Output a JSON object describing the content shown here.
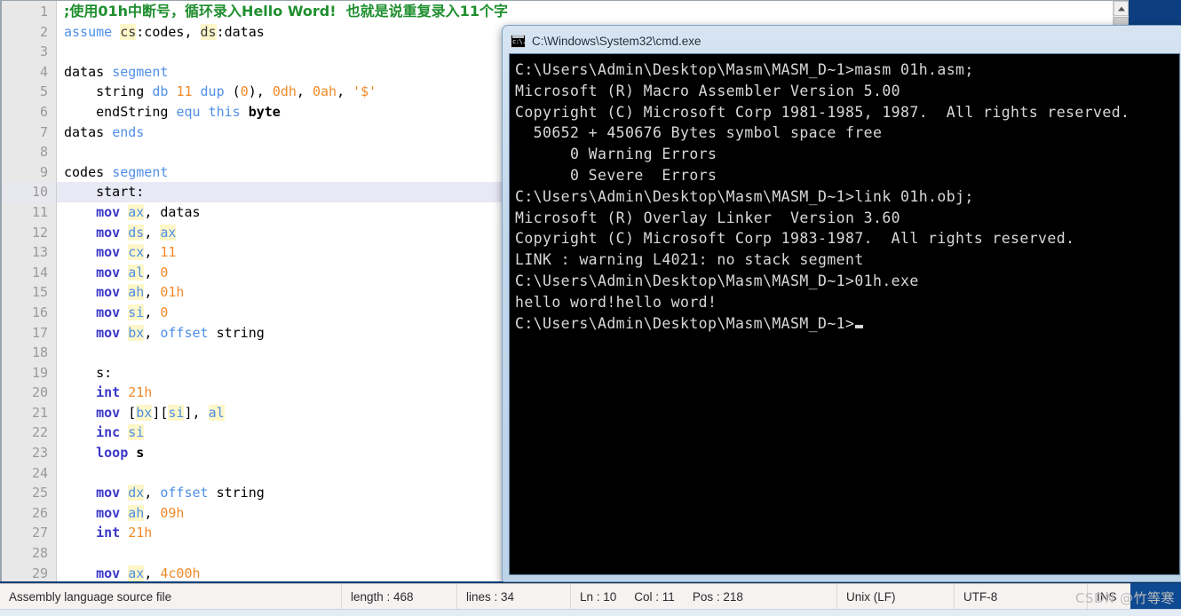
{
  "editor": {
    "current_line": 10,
    "lines": [
      {
        "n": 1,
        "tokens": [
          {
            "t": ";使用01h中断号，循环录入Hello Word!  也就是说重复录入11个字",
            "c": "tk-comment"
          }
        ]
      },
      {
        "n": 2,
        "tokens": [
          {
            "t": "assume ",
            "c": "tk-kw"
          },
          {
            "t": "cs",
            "c": "tk-reg-d"
          },
          {
            "t": ":codes, ",
            "c": "tk-plain"
          },
          {
            "t": "ds",
            "c": "tk-reg-d"
          },
          {
            "t": ":datas",
            "c": "tk-plain"
          }
        ]
      },
      {
        "n": 3,
        "tokens": [
          {
            "t": "",
            "c": "tk-plain"
          }
        ]
      },
      {
        "n": 4,
        "tokens": [
          {
            "t": "datas ",
            "c": "tk-plain"
          },
          {
            "t": "segment",
            "c": "tk-kw"
          }
        ]
      },
      {
        "n": 5,
        "tokens": [
          {
            "t": "    string ",
            "c": "tk-plain"
          },
          {
            "t": "db",
            "c": "tk-kw"
          },
          {
            "t": " ",
            "c": "tk-plain"
          },
          {
            "t": "11",
            "c": "tk-num"
          },
          {
            "t": " ",
            "c": "tk-plain"
          },
          {
            "t": "dup",
            "c": "tk-kw"
          },
          {
            "t": " (",
            "c": "tk-plain"
          },
          {
            "t": "0",
            "c": "tk-num"
          },
          {
            "t": "), ",
            "c": "tk-plain"
          },
          {
            "t": "0dh",
            "c": "tk-num"
          },
          {
            "t": ", ",
            "c": "tk-plain"
          },
          {
            "t": "0ah",
            "c": "tk-num"
          },
          {
            "t": ", ",
            "c": "tk-plain"
          },
          {
            "t": "'$'",
            "c": "tk-str"
          }
        ]
      },
      {
        "n": 6,
        "tokens": [
          {
            "t": "    endString ",
            "c": "tk-plain"
          },
          {
            "t": "equ",
            "c": "tk-kw"
          },
          {
            "t": " ",
            "c": "tk-plain"
          },
          {
            "t": "this",
            "c": "tk-kw"
          },
          {
            "t": " ",
            "c": "tk-plain"
          },
          {
            "t": "byte",
            "c": "tk-bold"
          }
        ]
      },
      {
        "n": 7,
        "tokens": [
          {
            "t": "datas ",
            "c": "tk-plain"
          },
          {
            "t": "ends",
            "c": "tk-kw"
          }
        ]
      },
      {
        "n": 8,
        "tokens": [
          {
            "t": "",
            "c": "tk-plain"
          }
        ]
      },
      {
        "n": 9,
        "tokens": [
          {
            "t": "codes ",
            "c": "tk-plain"
          },
          {
            "t": "segment",
            "c": "tk-kw"
          }
        ]
      },
      {
        "n": 10,
        "tokens": [
          {
            "t": "    start:",
            "c": "tk-plain"
          }
        ]
      },
      {
        "n": 11,
        "tokens": [
          {
            "t": "    ",
            "c": "tk-plain"
          },
          {
            "t": "mov",
            "c": "tk-ins"
          },
          {
            "t": " ",
            "c": "tk-plain"
          },
          {
            "t": "ax",
            "c": "tk-reg"
          },
          {
            "t": ", datas",
            "c": "tk-plain"
          }
        ]
      },
      {
        "n": 12,
        "tokens": [
          {
            "t": "    ",
            "c": "tk-plain"
          },
          {
            "t": "mov",
            "c": "tk-ins"
          },
          {
            "t": " ",
            "c": "tk-plain"
          },
          {
            "t": "ds",
            "c": "tk-reg"
          },
          {
            "t": ", ",
            "c": "tk-plain"
          },
          {
            "t": "ax",
            "c": "tk-reg"
          }
        ]
      },
      {
        "n": 13,
        "tokens": [
          {
            "t": "    ",
            "c": "tk-plain"
          },
          {
            "t": "mov",
            "c": "tk-ins"
          },
          {
            "t": " ",
            "c": "tk-plain"
          },
          {
            "t": "cx",
            "c": "tk-reg"
          },
          {
            "t": ", ",
            "c": "tk-plain"
          },
          {
            "t": "11",
            "c": "tk-num"
          }
        ]
      },
      {
        "n": 14,
        "tokens": [
          {
            "t": "    ",
            "c": "tk-plain"
          },
          {
            "t": "mov",
            "c": "tk-ins"
          },
          {
            "t": " ",
            "c": "tk-plain"
          },
          {
            "t": "al",
            "c": "tk-reg"
          },
          {
            "t": ", ",
            "c": "tk-plain"
          },
          {
            "t": "0",
            "c": "tk-num"
          }
        ]
      },
      {
        "n": 15,
        "tokens": [
          {
            "t": "    ",
            "c": "tk-plain"
          },
          {
            "t": "mov",
            "c": "tk-ins"
          },
          {
            "t": " ",
            "c": "tk-plain"
          },
          {
            "t": "ah",
            "c": "tk-reg"
          },
          {
            "t": ", ",
            "c": "tk-plain"
          },
          {
            "t": "01h",
            "c": "tk-num"
          }
        ]
      },
      {
        "n": 16,
        "tokens": [
          {
            "t": "    ",
            "c": "tk-plain"
          },
          {
            "t": "mov",
            "c": "tk-ins"
          },
          {
            "t": " ",
            "c": "tk-plain"
          },
          {
            "t": "si",
            "c": "tk-reg"
          },
          {
            "t": ", ",
            "c": "tk-plain"
          },
          {
            "t": "0",
            "c": "tk-num"
          }
        ]
      },
      {
        "n": 17,
        "tokens": [
          {
            "t": "    ",
            "c": "tk-plain"
          },
          {
            "t": "mov",
            "c": "tk-ins"
          },
          {
            "t": " ",
            "c": "tk-plain"
          },
          {
            "t": "bx",
            "c": "tk-reg"
          },
          {
            "t": ", ",
            "c": "tk-plain"
          },
          {
            "t": "offset",
            "c": "tk-kw"
          },
          {
            "t": " string",
            "c": "tk-plain"
          }
        ]
      },
      {
        "n": 18,
        "tokens": [
          {
            "t": "",
            "c": "tk-plain"
          }
        ]
      },
      {
        "n": 19,
        "tokens": [
          {
            "t": "    s:",
            "c": "tk-plain"
          }
        ]
      },
      {
        "n": 20,
        "tokens": [
          {
            "t": "    ",
            "c": "tk-plain"
          },
          {
            "t": "int",
            "c": "tk-ins"
          },
          {
            "t": " ",
            "c": "tk-plain"
          },
          {
            "t": "21h",
            "c": "tk-num"
          }
        ]
      },
      {
        "n": 21,
        "tokens": [
          {
            "t": "    ",
            "c": "tk-plain"
          },
          {
            "t": "mov",
            "c": "tk-ins"
          },
          {
            "t": " [",
            "c": "tk-plain"
          },
          {
            "t": "bx",
            "c": "tk-reg"
          },
          {
            "t": "][",
            "c": "tk-plain"
          },
          {
            "t": "si",
            "c": "tk-reg"
          },
          {
            "t": "], ",
            "c": "tk-plain"
          },
          {
            "t": "al",
            "c": "tk-reg"
          }
        ]
      },
      {
        "n": 22,
        "tokens": [
          {
            "t": "    ",
            "c": "tk-plain"
          },
          {
            "t": "inc",
            "c": "tk-ins"
          },
          {
            "t": " ",
            "c": "tk-plain"
          },
          {
            "t": "si",
            "c": "tk-reg"
          }
        ]
      },
      {
        "n": 23,
        "tokens": [
          {
            "t": "    ",
            "c": "tk-plain"
          },
          {
            "t": "loop",
            "c": "tk-ins"
          },
          {
            "t": " ",
            "c": "tk-plain"
          },
          {
            "t": "s",
            "c": "tk-bold"
          }
        ]
      },
      {
        "n": 24,
        "tokens": [
          {
            "t": "",
            "c": "tk-plain"
          }
        ]
      },
      {
        "n": 25,
        "tokens": [
          {
            "t": "    ",
            "c": "tk-plain"
          },
          {
            "t": "mov",
            "c": "tk-ins"
          },
          {
            "t": " ",
            "c": "tk-plain"
          },
          {
            "t": "dx",
            "c": "tk-reg"
          },
          {
            "t": ", ",
            "c": "tk-plain"
          },
          {
            "t": "offset",
            "c": "tk-kw"
          },
          {
            "t": " string",
            "c": "tk-plain"
          }
        ]
      },
      {
        "n": 26,
        "tokens": [
          {
            "t": "    ",
            "c": "tk-plain"
          },
          {
            "t": "mov",
            "c": "tk-ins"
          },
          {
            "t": " ",
            "c": "tk-plain"
          },
          {
            "t": "ah",
            "c": "tk-reg"
          },
          {
            "t": ", ",
            "c": "tk-plain"
          },
          {
            "t": "09h",
            "c": "tk-num"
          }
        ]
      },
      {
        "n": 27,
        "tokens": [
          {
            "t": "    ",
            "c": "tk-plain"
          },
          {
            "t": "int",
            "c": "tk-ins"
          },
          {
            "t": " ",
            "c": "tk-plain"
          },
          {
            "t": "21h",
            "c": "tk-num"
          }
        ]
      },
      {
        "n": 28,
        "tokens": [
          {
            "t": "",
            "c": "tk-plain"
          }
        ]
      },
      {
        "n": 29,
        "tokens": [
          {
            "t": "    ",
            "c": "tk-plain"
          },
          {
            "t": "mov",
            "c": "tk-ins"
          },
          {
            "t": " ",
            "c": "tk-plain"
          },
          {
            "t": "ax",
            "c": "tk-reg"
          },
          {
            "t": ", ",
            "c": "tk-plain"
          },
          {
            "t": "4c00h",
            "c": "tk-num"
          }
        ]
      }
    ]
  },
  "cmd": {
    "title": "C:\\Windows\\System32\\cmd.exe",
    "icon_glyph": "c:\\.",
    "console_lines": [
      "C:\\Users\\Admin\\Desktop\\Masm\\MASM_D~1>masm 01h.asm;",
      "Microsoft (R) Macro Assembler Version 5.00",
      "Copyright (C) Microsoft Corp 1981-1985, 1987.  All rights reserved.",
      "",
      "",
      "  50652 + 450676 Bytes symbol space free",
      "",
      "      0 Warning Errors",
      "      0 Severe  Errors",
      "",
      "C:\\Users\\Admin\\Desktop\\Masm\\MASM_D~1>link 01h.obj;",
      "",
      "Microsoft (R) Overlay Linker  Version 3.60",
      "Copyright (C) Microsoft Corp 1983-1987.  All rights reserved.",
      "",
      "LINK : warning L4021: no stack segment",
      "",
      "C:\\Users\\Admin\\Desktop\\Masm\\MASM_D~1>01h.exe",
      "hello word!hello word!",
      "",
      "C:\\Users\\Admin\\Desktop\\Masm\\MASM_D~1>"
    ]
  },
  "statusbar": {
    "file_type": "Assembly language source file",
    "length": "length : 468",
    "lines": "lines : 34",
    "ln": "Ln : 10",
    "col": "Col : 11",
    "pos": "Pos : 218",
    "eol": "Unix (LF)",
    "encoding": "UTF-8",
    "insert_mode": "INS"
  },
  "watermark": {
    "text": "CSDN @竹等寒"
  },
  "colors": {
    "comment": "#1f8f2f",
    "keyword": "#4f8fe8",
    "instruction": "#3a37c8",
    "number": "#f08a2a",
    "register_highlight": "#fdf6c8",
    "current_line": "#e9e9f6",
    "console_bg": "#000000",
    "console_fg": "#d8d8d8",
    "desktop": "#11417c"
  }
}
